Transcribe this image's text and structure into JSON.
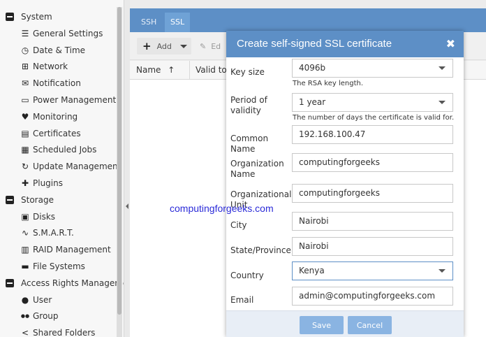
{
  "sidebar": {
    "rows": [
      {
        "type": "group",
        "label": "System"
      },
      {
        "type": "item",
        "icon": "sliders-icon",
        "glyph": "☰",
        "label": "General Settings"
      },
      {
        "type": "item",
        "icon": "clock-icon",
        "glyph": "◷",
        "label": "Date & Time"
      },
      {
        "type": "item",
        "icon": "network-icon",
        "glyph": "⊞",
        "label": "Network"
      },
      {
        "type": "item",
        "icon": "envelope-icon",
        "glyph": "✉",
        "label": "Notification"
      },
      {
        "type": "item",
        "icon": "battery-icon",
        "glyph": "▭",
        "label": "Power Management"
      },
      {
        "type": "item",
        "icon": "heartbeat-icon",
        "glyph": "♥",
        "label": "Monitoring"
      },
      {
        "type": "item",
        "icon": "certificate-icon",
        "glyph": "▤",
        "label": "Certificates"
      },
      {
        "type": "item",
        "icon": "calendar-icon",
        "glyph": "▦",
        "label": "Scheduled Jobs"
      },
      {
        "type": "item",
        "icon": "refresh-icon",
        "glyph": "↻",
        "label": "Update Management"
      },
      {
        "type": "item",
        "icon": "puzzle-icon",
        "glyph": "✚",
        "label": "Plugins"
      },
      {
        "type": "group",
        "label": "Storage"
      },
      {
        "type": "item",
        "icon": "disk-icon",
        "glyph": "▣",
        "label": "Disks"
      },
      {
        "type": "item",
        "icon": "pulse-icon",
        "glyph": "∿",
        "label": "S.M.A.R.T."
      },
      {
        "type": "item",
        "icon": "raid-icon",
        "glyph": "▥",
        "label": "RAID Management"
      },
      {
        "type": "item",
        "icon": "folder-icon",
        "glyph": "▬",
        "label": "File Systems"
      },
      {
        "type": "group",
        "label": "Access Rights Management"
      },
      {
        "type": "item",
        "icon": "user-icon",
        "glyph": "●",
        "label": "User"
      },
      {
        "type": "item",
        "icon": "group-icon",
        "glyph": "●●",
        "label": "Group"
      },
      {
        "type": "item",
        "icon": "share-icon",
        "glyph": "<",
        "label": "Shared Folders"
      }
    ]
  },
  "tabs": [
    {
      "label": "SSH",
      "active": false
    },
    {
      "label": "SSL",
      "active": true
    }
  ],
  "toolbar": {
    "add_label": "Add",
    "edit_label": "Ed"
  },
  "grid": {
    "columns": [
      "Name",
      "Valid to"
    ],
    "sort_glyph": "↑"
  },
  "watermark": "computingforgeeks.com",
  "dialog": {
    "title": "Create self-signed SSL certificate",
    "close_glyph": "✖",
    "fields": [
      {
        "label": "Key size",
        "value": "4096b",
        "kind": "select",
        "help": "The RSA key length."
      },
      {
        "label": "Period of validity",
        "value": "1 year",
        "kind": "select",
        "help": "The number of days the certificate is valid for."
      },
      {
        "label": "Common Name",
        "value": "192.168.100.47",
        "kind": "text"
      },
      {
        "label": "Organization Name",
        "value": "computingforgeeks",
        "kind": "text"
      },
      {
        "label": "Organizational Unit",
        "value": "computingforgeeks",
        "kind": "text"
      },
      {
        "label": "City",
        "value": "Nairobi",
        "kind": "text"
      },
      {
        "label": "State/Province",
        "value": "Nairobi",
        "kind": "text"
      },
      {
        "label": "Country",
        "value": "Kenya",
        "kind": "select"
      },
      {
        "label": "Email",
        "value": "admin@computingforgeeks.com",
        "kind": "text"
      }
    ],
    "save_label": "Save",
    "cancel_label": "Cancel"
  }
}
